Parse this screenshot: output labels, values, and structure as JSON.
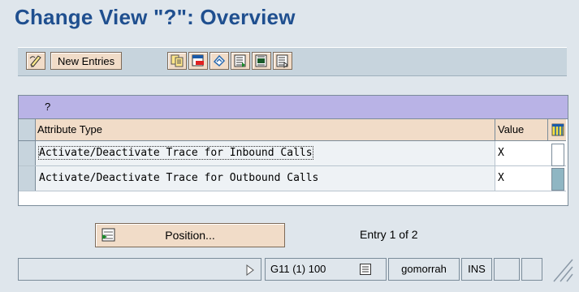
{
  "title": "Change View \"?\": Overview",
  "toolbar": {
    "new_entries_label": "New Entries",
    "icons": [
      "change-display-icon",
      "copy-icon",
      "delete-icon",
      "undo-icon",
      "select-all-icon",
      "select-block-icon",
      "deselect-all-icon"
    ]
  },
  "table": {
    "title": "?",
    "columns": {
      "attribute": "Attribute Type",
      "value": "Value"
    },
    "rows": [
      {
        "attribute": "Activate/Deactivate Trace for Inbound Calls",
        "value": "X"
      },
      {
        "attribute": "Activate/Deactivate Trace for Outbound Calls",
        "value": "X"
      }
    ]
  },
  "position": {
    "label": "Position...",
    "entry_text": "Entry 1 of 2"
  },
  "status": {
    "system": "G11 (1) 100",
    "host": "gomorrah",
    "mode": "INS"
  },
  "colors": {
    "title": "#1f4f8f",
    "table_title": "#b9b3e6",
    "button": "#f1dcc8",
    "background": "#dfe6ec"
  }
}
